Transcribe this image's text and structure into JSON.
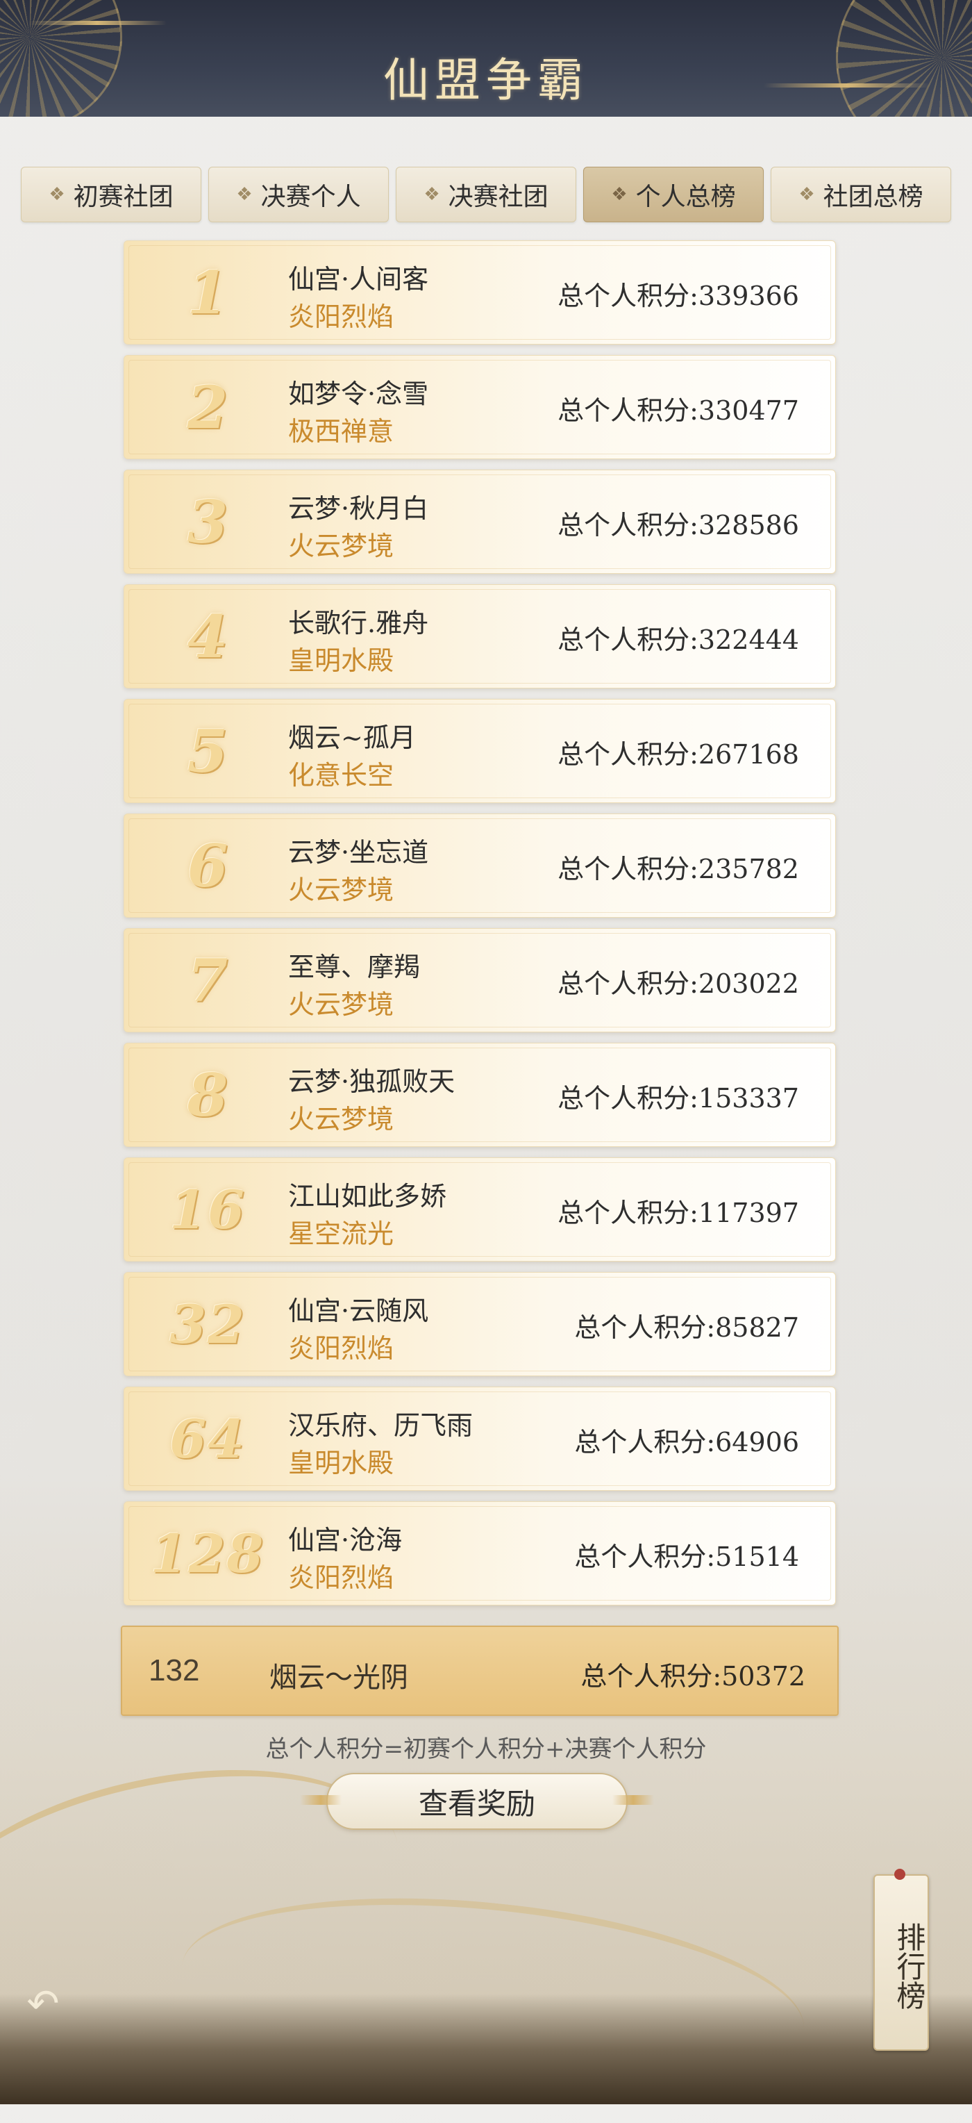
{
  "header": {
    "title": "仙盟争霸"
  },
  "tabs": [
    {
      "label": "初赛社团",
      "active": false
    },
    {
      "label": "决赛个人",
      "active": false
    },
    {
      "label": "决赛社团",
      "active": false
    },
    {
      "label": "个人总榜",
      "active": true
    },
    {
      "label": "社团总榜",
      "active": false
    }
  ],
  "tab_icon_glyph": "❖",
  "rankings": [
    {
      "rank": "1",
      "player": "仙宫·人间客",
      "club": "炎阳烈焰",
      "score": "总个人积分:339366"
    },
    {
      "rank": "2",
      "player": "如梦令·念雪",
      "club": "极西禅意",
      "score": "总个人积分:330477"
    },
    {
      "rank": "3",
      "player": "云梦·秋月白",
      "club": "火云梦境",
      "score": "总个人积分:328586"
    },
    {
      "rank": "4",
      "player": "长歌行.雅舟",
      "club": "皇明水殿",
      "score": "总个人积分:322444"
    },
    {
      "rank": "5",
      "player": "烟云~孤月",
      "club": "化意长空",
      "score": "总个人积分:267168"
    },
    {
      "rank": "6",
      "player": "云梦·坐忘道",
      "club": "火云梦境",
      "score": "总个人积分:235782"
    },
    {
      "rank": "7",
      "player": "至尊、摩羯",
      "club": "火云梦境",
      "score": "总个人积分:203022"
    },
    {
      "rank": "8",
      "player": "云梦·独孤败天",
      "club": "火云梦境",
      "score": "总个人积分:153337"
    },
    {
      "rank": "16",
      "player": "江山如此多娇",
      "club": "星空流光",
      "score": "总个人积分:117397"
    },
    {
      "rank": "32",
      "player": "仙宫·云随风",
      "club": "炎阳烈焰",
      "score": "总个人积分:85827"
    },
    {
      "rank": "64",
      "player": "汉乐府、历飞雨",
      "club": "皇明水殿",
      "score": "总个人积分:64906"
    },
    {
      "rank": "128",
      "player": "仙宫·沧海",
      "club": "炎阳烈焰",
      "score": "总个人积分:51514"
    }
  ],
  "self_entry": {
    "rank": "132",
    "player": "烟云～光阴",
    "score": "总个人积分:50372"
  },
  "formula": "总个人积分=初赛个人积分+决赛个人积分",
  "reward_button": "查看奖励",
  "side_button": "排行榜",
  "back_icon": "↶",
  "colors": {
    "header_bg": "#2c3140",
    "title_gold": "#f3e3b8",
    "club_orange": "#c98a2d",
    "self_row_bg": "#efd29a"
  }
}
